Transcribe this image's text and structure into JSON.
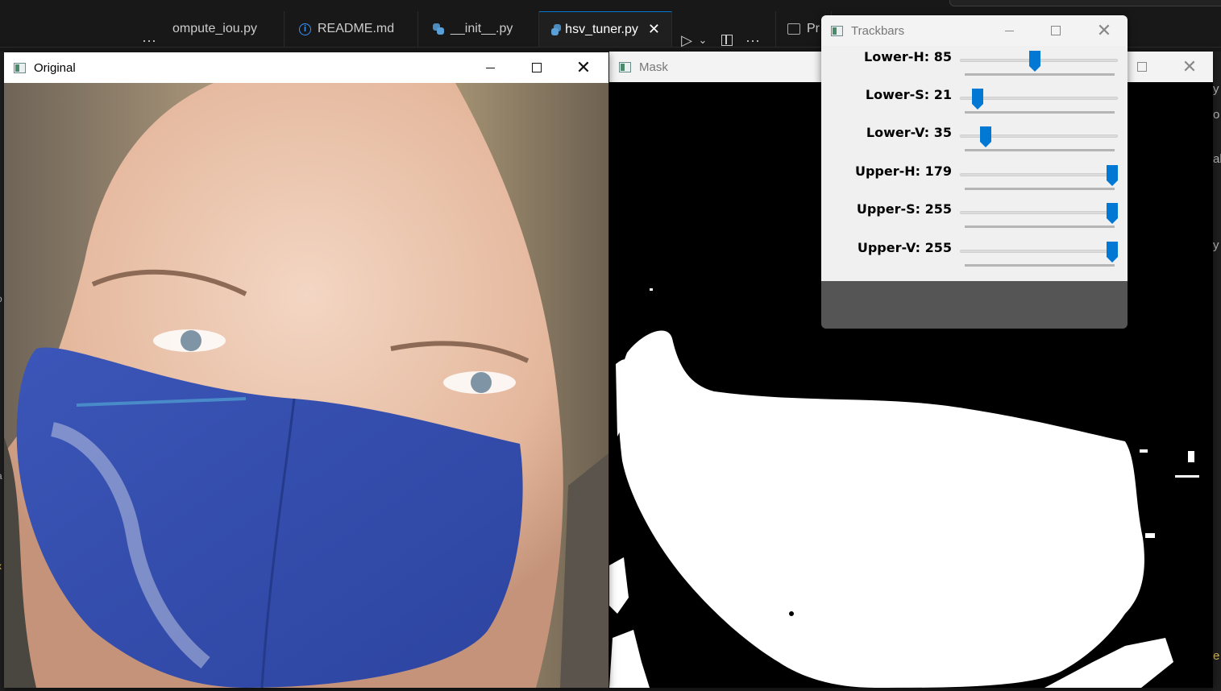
{
  "editor": {
    "tabs": [
      {
        "label": "ompute_iou.py",
        "icon": "none"
      },
      {
        "label": "README.md",
        "icon": "info-icon"
      },
      {
        "label": "__init__.py",
        "icon": "python-icon"
      },
      {
        "label": "hsv_tuner.py",
        "icon": "python-icon",
        "active": true
      },
      {
        "label": "Pr",
        "icon": "preview-icon"
      }
    ],
    "overflow_glyph": "···",
    "more_glyph": "···",
    "run_glyph": "▷",
    "chevron_glyph": "⌄",
    "close_glyph": "✕",
    "fragments": {
      "right_1": "y",
      "right_2": "o",
      "right_3": "al",
      "right_4": "y",
      "right_5": "e",
      "left_1": "o",
      "left_2": "a",
      "left_3": "x"
    },
    "accent_color": "#0078d4"
  },
  "windows": {
    "original": {
      "title": "Original"
    },
    "mask": {
      "title": "Mask"
    },
    "trackbars": {
      "title": "Trackbars",
      "thumb_color": "#0078d4",
      "sliders": [
        {
          "label": "Lower-H: 85",
          "value": 85,
          "max": 179
        },
        {
          "label": "Lower-S: 21",
          "value": 21,
          "max": 255
        },
        {
          "label": "Lower-V: 35",
          "value": 35,
          "max": 255
        },
        {
          "label": "Upper-H: 179",
          "value": 179,
          "max": 179
        },
        {
          "label": "Upper-S: 255",
          "value": 255,
          "max": 255
        },
        {
          "label": "Upper-V: 255",
          "value": 255,
          "max": 255
        }
      ]
    }
  }
}
